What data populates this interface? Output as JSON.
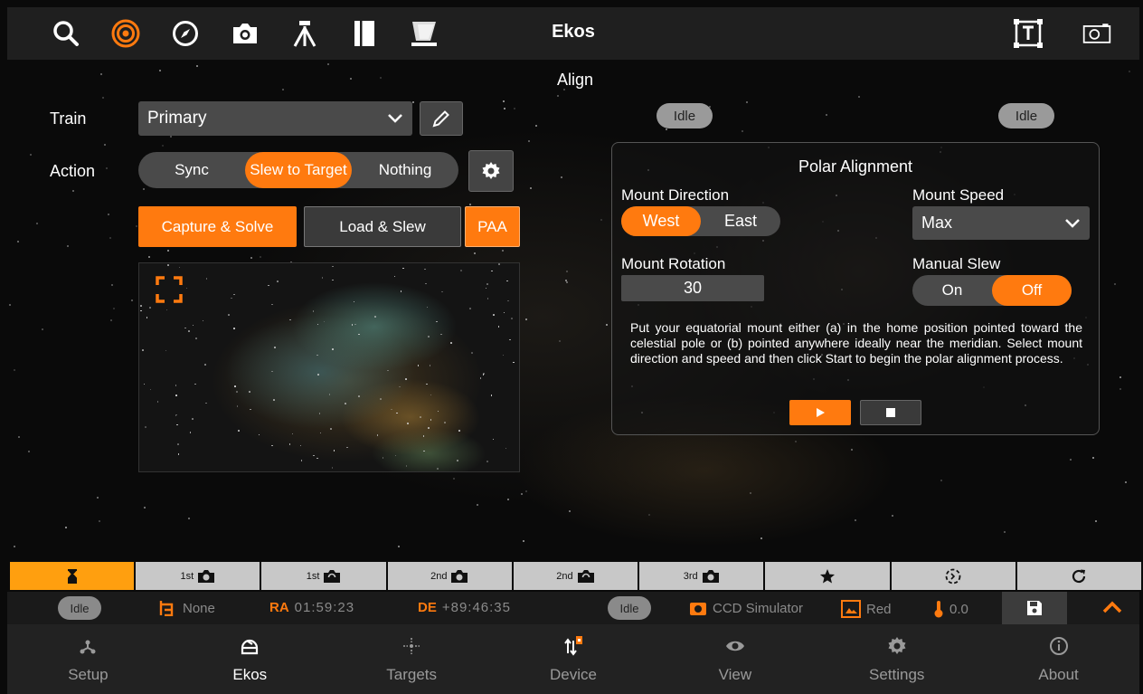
{
  "topbar": {
    "title": "Ekos",
    "icons": [
      "search-icon",
      "target-icon",
      "compass-icon",
      "camera-icon",
      "tripod-icon",
      "notebook-icon",
      "telescope-icon",
      "text-frame-icon",
      "screenshot-icon"
    ]
  },
  "section_title": "Align",
  "train": {
    "label": "Train",
    "value": "Primary"
  },
  "action": {
    "label": "Action",
    "options": [
      "Sync",
      "Slew to Target",
      "Nothing"
    ],
    "selected": "Slew to Target"
  },
  "buttons": {
    "capture_solve": "Capture & Solve",
    "load_slew": "Load & Slew",
    "paa": "PAA"
  },
  "status_pills": {
    "left": "Idle",
    "right": "Idle"
  },
  "polar": {
    "title": "Polar Alignment",
    "mount_direction_label": "Mount Direction",
    "direction_options": [
      "West",
      "East"
    ],
    "direction_selected": "West",
    "mount_speed_label": "Mount Speed",
    "mount_speed_value": "Max",
    "mount_rotation_label": "Mount Rotation",
    "mount_rotation_value": "30",
    "manual_slew_label": "Manual Slew",
    "manual_slew_options": [
      "On",
      "Off"
    ],
    "manual_slew_selected": "Off",
    "description": "Put your equatorial mount either (a) in the home position pointed toward the celestial pole or (b) pointed anywhere ideally near the meridian. Select mount direction and speed and then click Start to begin the polar alignment process."
  },
  "progress": [
    {
      "label": "",
      "icon": "hourglass-icon",
      "active": true
    },
    {
      "label": "1st",
      "icon": "camera-icon"
    },
    {
      "label": "1st",
      "icon": "camera-rotate-icon"
    },
    {
      "label": "2nd",
      "icon": "camera-icon"
    },
    {
      "label": "2nd",
      "icon": "camera-rotate-icon"
    },
    {
      "label": "3rd",
      "icon": "camera-icon"
    },
    {
      "label": "",
      "icon": "star-icon"
    },
    {
      "label": "",
      "icon": "dashed-circle-icon"
    },
    {
      "label": "",
      "icon": "refresh-icon"
    }
  ],
  "statusbar": {
    "idle1": "Idle",
    "none": "None",
    "ra_label": "RA",
    "ra_value": "01:59:23",
    "de_label": "DE",
    "de_value": "+89:46:35",
    "idle2": "Idle",
    "camera": "CCD Simulator",
    "filter": "Red",
    "temp": "0.0"
  },
  "nav": [
    {
      "label": "Setup",
      "icon": "setup-icon"
    },
    {
      "label": "Ekos",
      "icon": "ekos-icon",
      "active": true
    },
    {
      "label": "Targets",
      "icon": "targets-icon"
    },
    {
      "label": "Device",
      "icon": "device-icon"
    },
    {
      "label": "View",
      "icon": "eye-icon"
    },
    {
      "label": "Settings",
      "icon": "gear-icon"
    },
    {
      "label": "About",
      "icon": "info-icon"
    }
  ],
  "colors": {
    "accent": "#ff7a0f",
    "bar": "#1f1f1f"
  }
}
